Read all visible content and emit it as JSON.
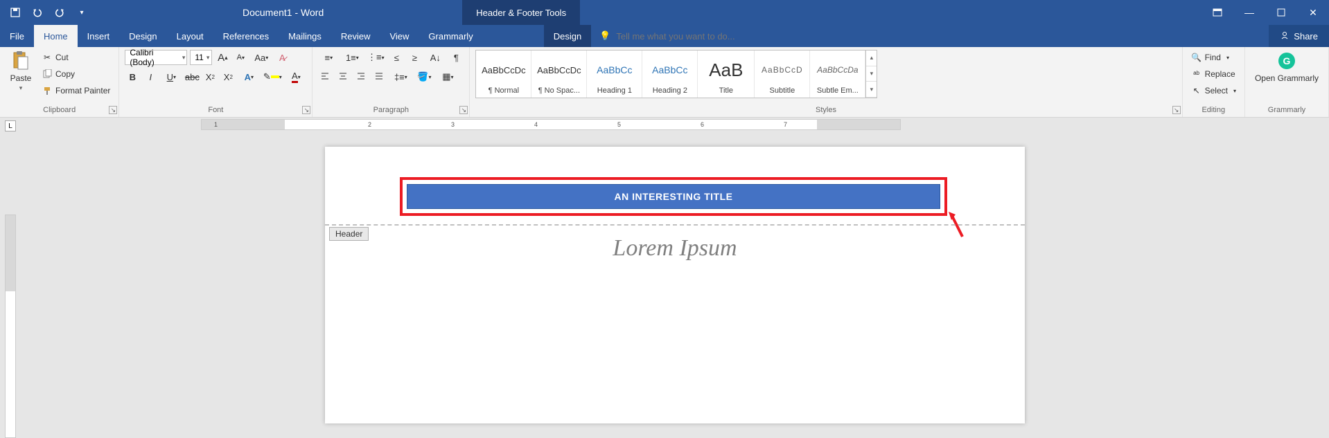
{
  "titlebar": {
    "document": "Document1 - Word",
    "context_tools": "Header & Footer Tools"
  },
  "tabs": {
    "file": "File",
    "home": "Home",
    "insert": "Insert",
    "design": "Design",
    "layout": "Layout",
    "references": "References",
    "mailings": "Mailings",
    "review": "Review",
    "view": "View",
    "grammarly": "Grammarly",
    "context_design": "Design",
    "tellme_placeholder": "Tell me what you want to do...",
    "share": "Share"
  },
  "clipboard": {
    "paste": "Paste",
    "cut": "Cut",
    "copy": "Copy",
    "format_painter": "Format Painter",
    "label": "Clipboard"
  },
  "font": {
    "name": "Calibri (Body)",
    "size": "11",
    "label": "Font"
  },
  "paragraph": {
    "label": "Paragraph"
  },
  "styles": {
    "label": "Styles",
    "items": [
      {
        "preview": "AaBbCcDc",
        "name": "¶ Normal",
        "cls": ""
      },
      {
        "preview": "AaBbCcDc",
        "name": "¶ No Spac...",
        "cls": ""
      },
      {
        "preview": "AaBbCc",
        "name": "Heading 1",
        "cls": "heading"
      },
      {
        "preview": "AaBbCc",
        "name": "Heading 2",
        "cls": "heading"
      },
      {
        "preview": "AaB",
        "name": "Title",
        "cls": "title"
      },
      {
        "preview": "AaBbCcD",
        "name": "Subtitle",
        "cls": "subtitle"
      },
      {
        "preview": "AaBbCcDa",
        "name": "Subtle Em...",
        "cls": "emph"
      }
    ]
  },
  "editing": {
    "find": "Find",
    "replace": "Replace",
    "select": "Select",
    "label": "Editing"
  },
  "grammarly_group": {
    "open": "Open Grammarly",
    "label": "Grammarly"
  },
  "ruler": {
    "marks": [
      "1",
      "2",
      "3",
      "4",
      "5",
      "6",
      "7"
    ]
  },
  "document": {
    "header_text": "AN INTERESTING TITLE",
    "header_tag": "Header",
    "body_title": "Lorem Ipsum"
  }
}
